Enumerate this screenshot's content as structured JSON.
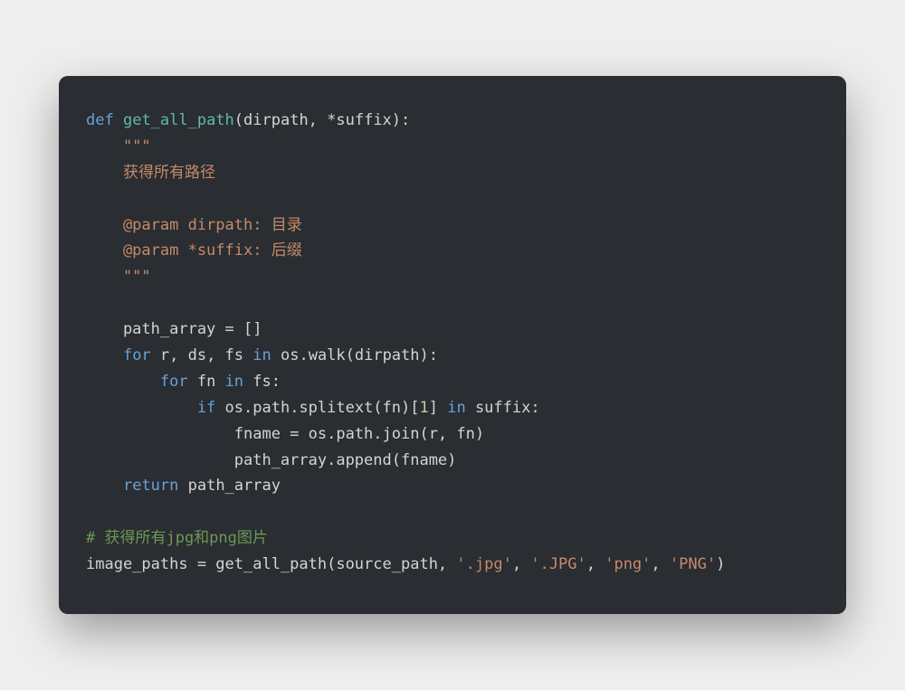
{
  "code": {
    "line1_def": "def",
    "line1_fn": "get_all_path",
    "line1_params": "(dirpath, *suffix):",
    "line2_docopen": "    \"\"\"",
    "line3_doc": "    获得所有路径",
    "line4_blank": "",
    "line5_doc": "    @param dirpath: 目录",
    "line6_doc": "    @param *suffix: 后缀",
    "line7_docclose": "    \"\"\"",
    "line8_blank": "",
    "line9_assign": "    path_array = []",
    "line10_for": "for",
    "line10_vars": " r, ds, fs ",
    "line10_in": "in",
    "line10_rest": " os.walk(dirpath):",
    "line11_indent": "        ",
    "line11_for": "for",
    "line11_vars": " fn ",
    "line11_in": "in",
    "line11_rest": " fs:",
    "line12_indent": "            ",
    "line12_if": "if",
    "line12_mid": " os.path.splitext(fn)[",
    "line12_num": "1",
    "line12_bracket": "] ",
    "line12_in": "in",
    "line12_rest": " suffix:",
    "line13": "                fname = os.path.join(r, fn)",
    "line14": "                path_array.append(fname)",
    "line15_indent": "    ",
    "line15_return": "return",
    "line15_rest": " path_array",
    "line16_blank": "",
    "line17_comment": "# 获得所有jpg和png图片",
    "line18_pre": "image_paths = get_all_path(source_path, ",
    "line18_s1": "'.jpg'",
    "line18_c1": ", ",
    "line18_s2": "'.JPG'",
    "line18_c2": ", ",
    "line18_s3": "'png'",
    "line18_c3": ", ",
    "line18_s4": "'PNG'",
    "line18_close": ")"
  }
}
